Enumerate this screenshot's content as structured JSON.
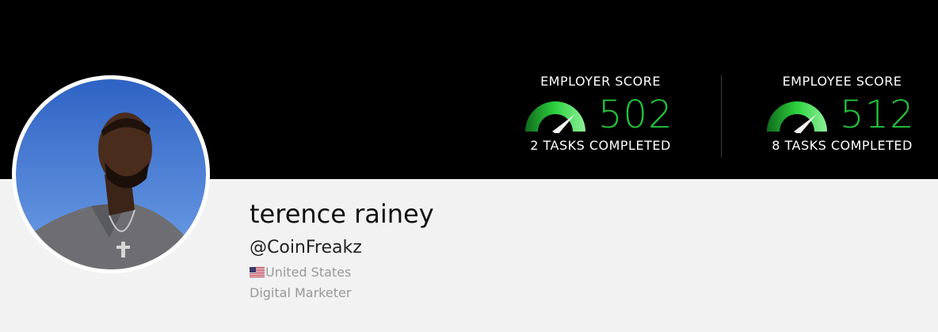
{
  "profile": {
    "name": "terence rainey",
    "handle": "@CoinFreakz",
    "country": "United States",
    "country_flag": "us-flag-icon",
    "occupation": "Digital Marketer"
  },
  "scores": {
    "employer": {
      "title": "EMPLOYER SCORE",
      "value": "502",
      "tasks": "2 TASKS COMPLETED"
    },
    "employee": {
      "title": "EMPLOYEE SCORE",
      "value": "512",
      "tasks": "8 TASKS COMPLETED"
    }
  },
  "colors": {
    "banner": "#000000",
    "background": "#f2f2f2",
    "score_green": "#22c33a"
  }
}
